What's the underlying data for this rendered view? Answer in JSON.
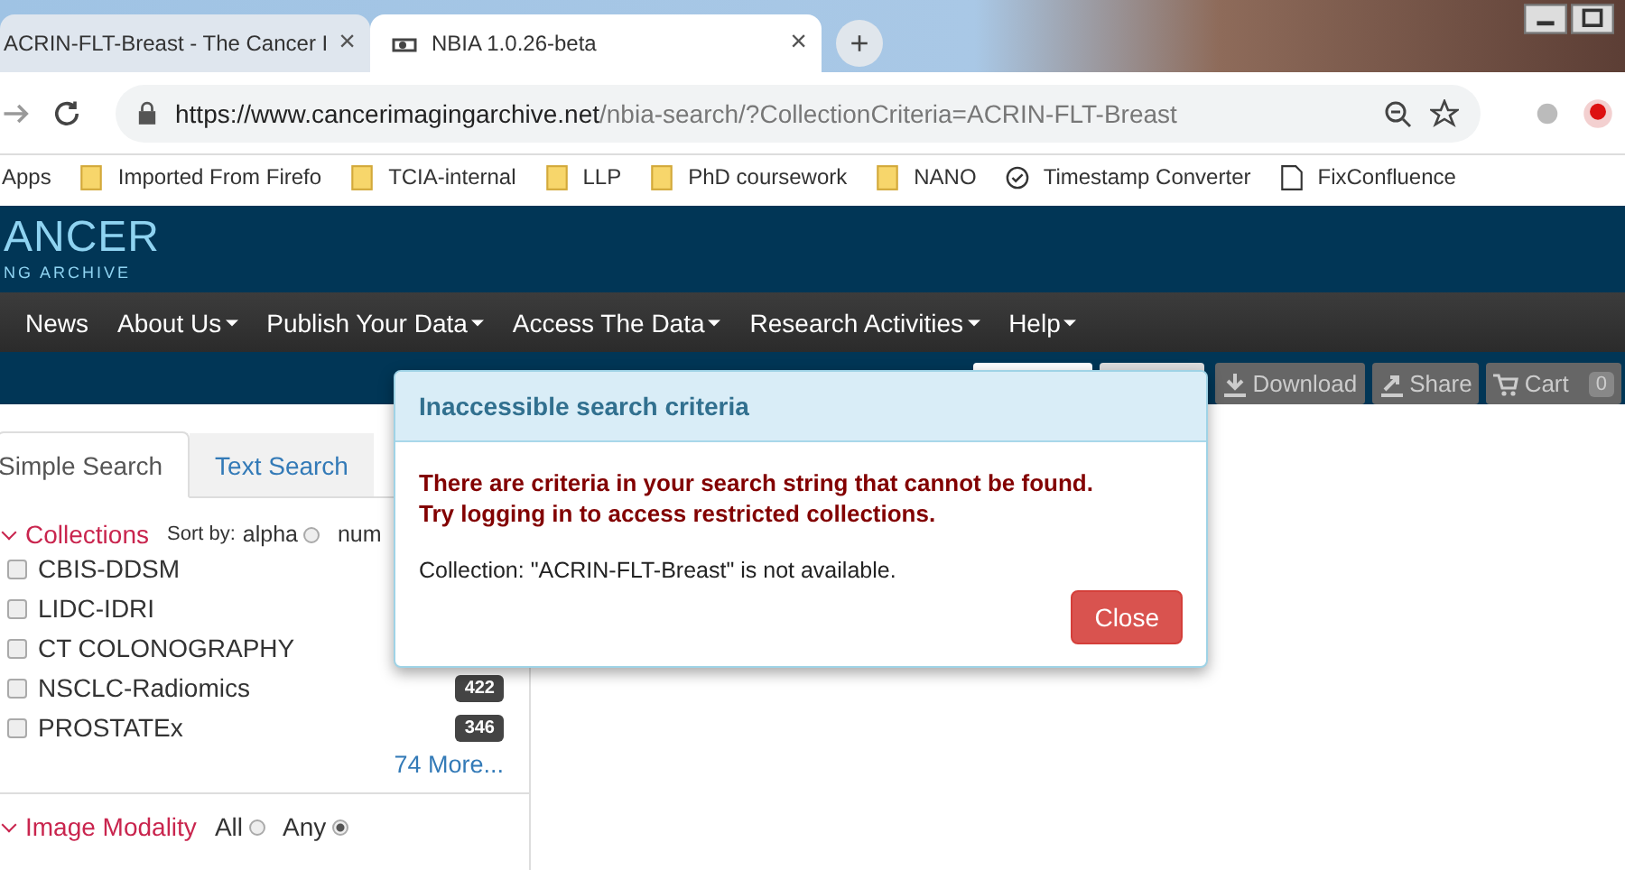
{
  "browser": {
    "tabs": [
      {
        "title": "ACRIN-FLT-Breast - The Cancer I",
        "selected": false,
        "close": "×"
      },
      {
        "title": "NBIA 1.0.26-beta",
        "selected": true,
        "close": "×"
      }
    ],
    "new_tab": "+",
    "url": {
      "host": "https://www.cancerimagingarchive.net",
      "path": "/nbia-search/?CollectionCriteria=ACRIN-FLT-Breast"
    },
    "bookmarks": [
      {
        "kind": "apps",
        "label": "Apps"
      },
      {
        "kind": "folder",
        "label": "Imported From Firefo"
      },
      {
        "kind": "folder",
        "label": "TCIA-internal"
      },
      {
        "kind": "folder",
        "label": "LLP"
      },
      {
        "kind": "folder",
        "label": "PhD coursework"
      },
      {
        "kind": "folder",
        "label": "NANO"
      },
      {
        "kind": "clock",
        "label": "Timestamp Converter"
      },
      {
        "kind": "page",
        "label": "FixConfluence"
      }
    ]
  },
  "logo": {
    "line_1": "ANCER",
    "line_2": "NG ARCHIVE"
  },
  "nav": [
    "News",
    "About Us",
    "Publish Your Data",
    "Access The Data",
    "Research Activities",
    "Help"
  ],
  "toolbar": {
    "download": "Download",
    "share": "Share",
    "cart": "Cart",
    "cart_count": "0"
  },
  "search_tabs": [
    {
      "label": "Simple Search",
      "selected": true
    },
    {
      "label": "Text Search",
      "selected": false
    }
  ],
  "collections": {
    "title": "Collections",
    "sort_label": "Sort by:",
    "sort_options": [
      {
        "label": "alpha",
        "selected": false
      },
      {
        "label": "num"
      }
    ],
    "items": [
      {
        "name": "CBIS-DDSM",
        "checked": false
      },
      {
        "name": "LIDC-IDRI",
        "checked": false
      },
      {
        "name": "CT COLONOGRAPHY",
        "checked": false
      },
      {
        "name": "NSCLC-Radiomics",
        "checked": false,
        "count": "422"
      },
      {
        "name": "PROSTATEx",
        "checked": false,
        "count": "346"
      }
    ],
    "more": "74 More..."
  },
  "modality": {
    "title": "Image Modality",
    "options": [
      {
        "label": "All",
        "selected": false
      },
      {
        "label": "Any",
        "selected": true
      }
    ]
  },
  "modal": {
    "title": "Inaccessible search criteria",
    "warning": [
      "There are criteria in your search string that cannot be found.",
      "Try logging in to access restricted collections."
    ],
    "message": "Collection: \"ACRIN-FLT-Breast\" is not available.",
    "button": "Close"
  }
}
